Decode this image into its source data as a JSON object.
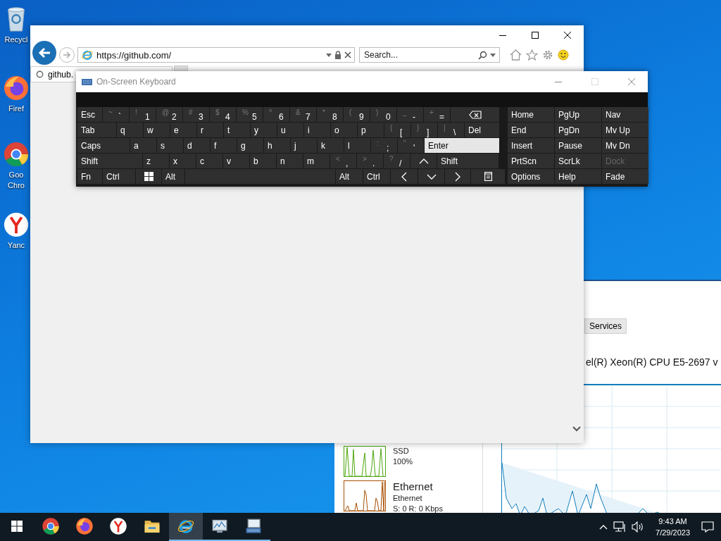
{
  "desktop_icons": [
    {
      "kind": "recycle",
      "label": "Recycl"
    },
    {
      "kind": "firefox",
      "label": "Firef"
    },
    {
      "kind": "chrome",
      "label": "Goo Chro"
    },
    {
      "kind": "yandex",
      "label": "Yanc"
    }
  ],
  "task_manager": {
    "tab": "Services",
    "cpu_title": "el(R) Xeon(R) CPU E5-2697 v",
    "devices": [
      {
        "kind": "disk",
        "subtitle": "SSD",
        "reading": "100%"
      },
      {
        "kind": "network",
        "title": "Ethernet",
        "subtitle": "Ethernet",
        "reading": "S: 0 R: 0 Kbps"
      }
    ]
  },
  "browser": {
    "url": "https://github.com/",
    "search_placeholder": "Search...",
    "tab": {
      "title": "github.",
      "loading": true
    }
  },
  "osk": {
    "title": "On-Screen Keyboard",
    "rows": [
      {
        "keys": [
          {
            "kind": "text",
            "label": "Esc",
            "hover": false
          },
          {
            "kind": "dual",
            "shift": "~",
            "main": "`",
            "hover": false
          },
          {
            "kind": "dual",
            "shift": "!",
            "main": "1",
            "hover": false
          },
          {
            "kind": "dual",
            "shift": "@",
            "main": "2",
            "hover": false
          },
          {
            "kind": "dual",
            "shift": "#",
            "main": "3",
            "hover": false
          },
          {
            "kind": "dual",
            "shift": "$",
            "main": "4",
            "hover": false
          },
          {
            "kind": "dual",
            "shift": "%",
            "main": "5",
            "hover": false
          },
          {
            "kind": "dual",
            "shift": "^",
            "main": "6",
            "hover": false
          },
          {
            "kind": "dual",
            "shift": "&",
            "main": "7",
            "hover": false
          },
          {
            "kind": "dual",
            "shift": "*",
            "main": "8",
            "hover": false
          },
          {
            "kind": "dual",
            "shift": "(",
            "main": "9",
            "hover": false
          },
          {
            "kind": "dual",
            "shift": ")",
            "main": "0",
            "hover": false
          },
          {
            "kind": "dual",
            "shift": "_",
            "main": "-",
            "hover": false
          },
          {
            "kind": "dual",
            "shift": "+",
            "main": "=",
            "hover": false
          },
          {
            "kind": "backspace",
            "hover": false
          }
        ]
      },
      {
        "keys": [
          {
            "kind": "text",
            "label": "Tab",
            "hover": false
          },
          {
            "kind": "text",
            "label": "q",
            "hover": false
          },
          {
            "kind": "text",
            "label": "w",
            "hover": false
          },
          {
            "kind": "text",
            "label": "e",
            "hover": false
          },
          {
            "kind": "text",
            "label": "r",
            "hover": false
          },
          {
            "kind": "text",
            "label": "t",
            "hover": false
          },
          {
            "kind": "text",
            "label": "y",
            "hover": false
          },
          {
            "kind": "text",
            "label": "u",
            "hover": false
          },
          {
            "kind": "text",
            "label": "i",
            "hover": false
          },
          {
            "kind": "text",
            "label": "o",
            "hover": false
          },
          {
            "kind": "text",
            "label": "p",
            "hover": false
          },
          {
            "kind": "dual",
            "shift": "{",
            "main": "[",
            "hover": false
          },
          {
            "kind": "dual",
            "shift": "}",
            "main": "]",
            "hover": false
          },
          {
            "kind": "dual",
            "shift": "|",
            "main": "\\",
            "hover": false
          },
          {
            "kind": "text",
            "label": "Del",
            "hover": false
          }
        ]
      },
      {
        "keys": [
          {
            "kind": "text",
            "label": "Caps",
            "hover": false
          },
          {
            "kind": "text",
            "label": "a",
            "hover": false
          },
          {
            "kind": "text",
            "label": "s",
            "hover": false
          },
          {
            "kind": "text",
            "label": "d",
            "hover": false
          },
          {
            "kind": "text",
            "label": "f",
            "hover": false
          },
          {
            "kind": "text",
            "label": "g",
            "hover": false
          },
          {
            "kind": "text",
            "label": "h",
            "hover": false
          },
          {
            "kind": "text",
            "label": "j",
            "hover": false
          },
          {
            "kind": "text",
            "label": "k",
            "hover": false
          },
          {
            "kind": "text",
            "label": "l",
            "hover": false
          },
          {
            "kind": "dual",
            "shift": ":",
            "main": ";",
            "hover": false
          },
          {
            "kind": "dual",
            "shift": "\"",
            "main": "'",
            "hover": false
          },
          {
            "kind": "text",
            "label": "Enter",
            "hover": true
          }
        ]
      },
      {
        "keys": [
          {
            "kind": "text",
            "label": "Shift",
            "hover": false
          },
          {
            "kind": "text",
            "label": "z",
            "hover": false
          },
          {
            "kind": "text",
            "label": "x",
            "hover": false
          },
          {
            "kind": "text",
            "label": "c",
            "hover": false
          },
          {
            "kind": "text",
            "label": "v",
            "hover": false
          },
          {
            "kind": "text",
            "label": "b",
            "hover": false
          },
          {
            "kind": "text",
            "label": "n",
            "hover": false
          },
          {
            "kind": "text",
            "label": "m",
            "hover": false
          },
          {
            "kind": "dual",
            "shift": "<",
            "main": ",",
            "hover": false
          },
          {
            "kind": "dual",
            "shift": ">",
            "main": ".",
            "hover": false
          },
          {
            "kind": "dual",
            "shift": "?",
            "main": "/",
            "hover": false
          },
          {
            "kind": "up",
            "hover": false
          },
          {
            "kind": "text",
            "label": "Shift",
            "hover": false
          }
        ]
      },
      {
        "keys": [
          {
            "kind": "text",
            "label": "Fn",
            "hover": false
          },
          {
            "kind": "text",
            "label": "Ctrl",
            "hover": false
          },
          {
            "kind": "windows",
            "hover": false
          },
          {
            "kind": "text",
            "label": "Alt",
            "hover": false
          },
          {
            "kind": "space",
            "hover": false
          },
          {
            "kind": "text",
            "label": "Alt",
            "hover": false
          },
          {
            "kind": "text",
            "label": "Ctrl",
            "hover": false
          },
          {
            "kind": "left",
            "hover": false
          },
          {
            "kind": "down",
            "hover": false
          },
          {
            "kind": "right",
            "hover": false
          },
          {
            "kind": "menu",
            "hover": false
          }
        ]
      }
    ],
    "nav_rows": [
      {
        "keys": [
          {
            "label": "Home",
            "disabled": false
          },
          {
            "label": "PgUp",
            "disabled": false
          },
          {
            "label": "Nav",
            "disabled": false
          }
        ]
      },
      {
        "keys": [
          {
            "label": "End",
            "disabled": false
          },
          {
            "label": "PgDn",
            "disabled": false
          },
          {
            "label": "Mv Up",
            "disabled": false
          }
        ]
      },
      {
        "keys": [
          {
            "label": "Insert",
            "disabled": false
          },
          {
            "label": "Pause",
            "disabled": false
          },
          {
            "label": "Mv Dn",
            "disabled": false
          }
        ]
      },
      {
        "keys": [
          {
            "label": "PrtScn",
            "disabled": false
          },
          {
            "label": "ScrLk",
            "disabled": false
          },
          {
            "label": "Dock",
            "disabled": true
          }
        ]
      },
      {
        "keys": [
          {
            "label": "Options",
            "disabled": false
          },
          {
            "label": "Help",
            "disabled": false
          },
          {
            "label": "Fade",
            "disabled": false
          }
        ]
      }
    ]
  },
  "taskbar": {
    "apps": [
      {
        "kind": "chrome",
        "running": false,
        "selected": false
      },
      {
        "kind": "firefox",
        "running": false,
        "selected": false
      },
      {
        "kind": "yandex",
        "running": false,
        "selected": false
      },
      {
        "kind": "folder",
        "running": false,
        "selected": false
      },
      {
        "kind": "ie",
        "running": true,
        "selected": true
      },
      {
        "kind": "monitor",
        "running": true,
        "selected": false
      },
      {
        "kind": "keyboard",
        "running": true,
        "selected": false
      }
    ],
    "time": "9:43 AM",
    "date": "7/29/2023"
  }
}
